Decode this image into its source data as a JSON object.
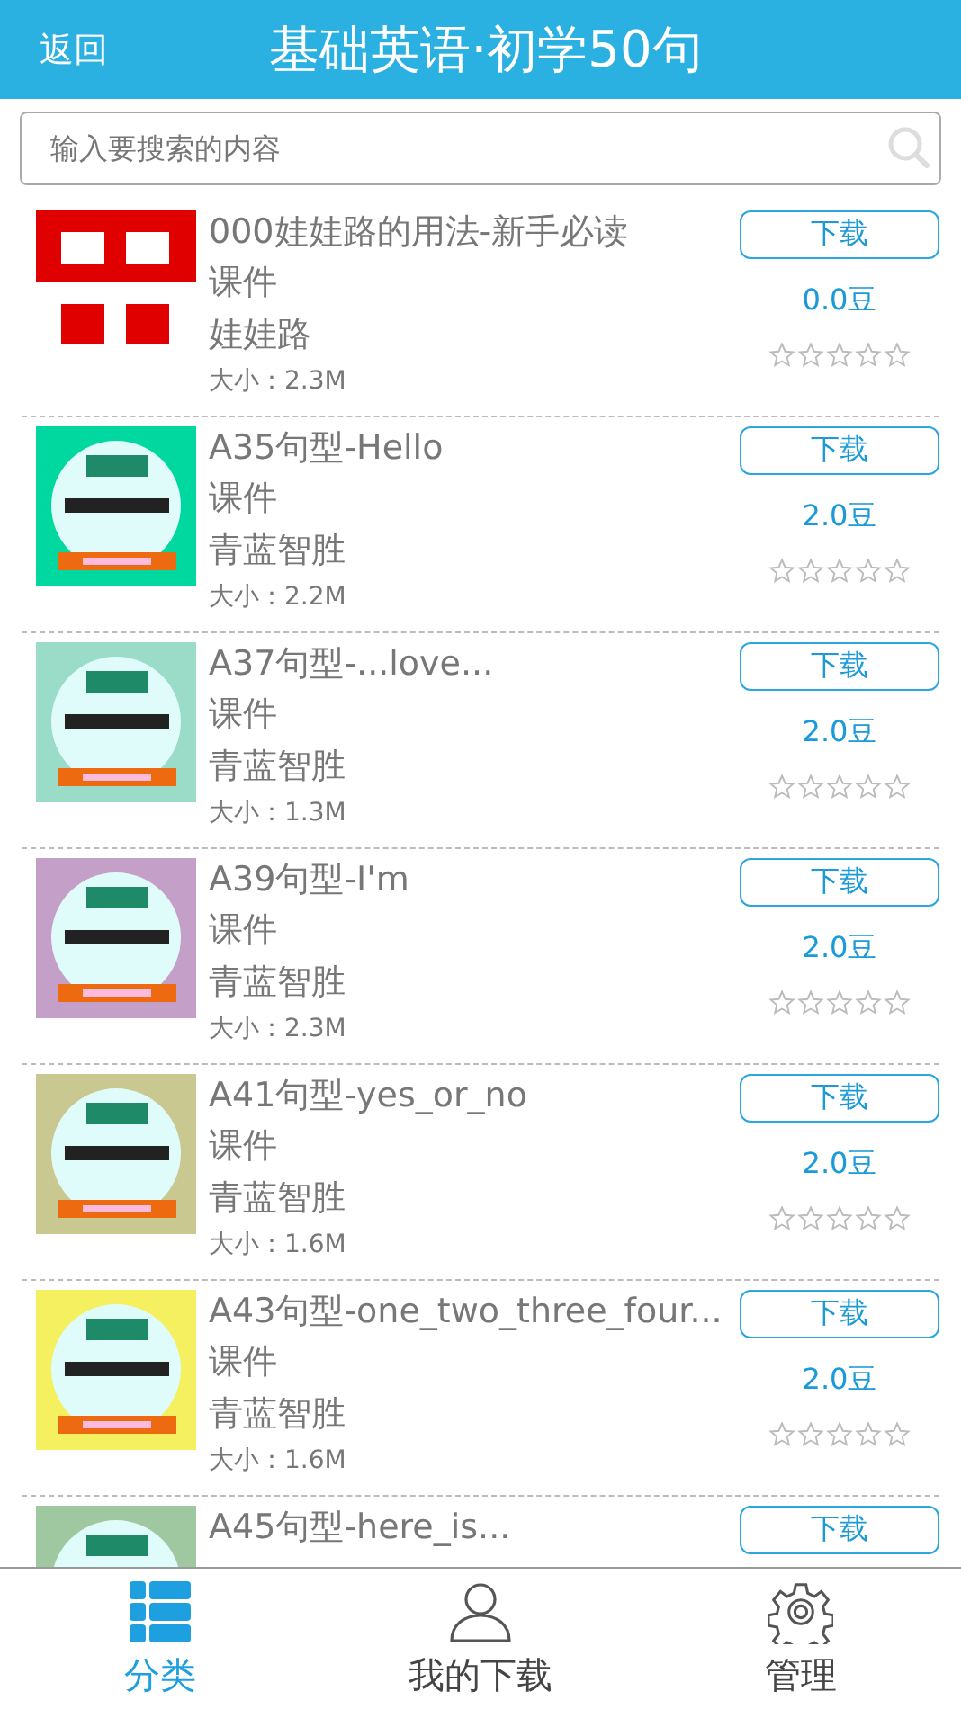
{
  "header": {
    "back": "返回",
    "title": "基础英语·初学50句"
  },
  "search": {
    "placeholder": "输入要搜索的内容"
  },
  "items": [
    {
      "title": "000娃娃路的用法-新手必读",
      "type": "课件",
      "author": "娃娃路",
      "size": "大小：2.3M",
      "button": "下载",
      "price": "0.0豆",
      "stars": 0
    },
    {
      "title": "A35句型-Hello",
      "type": "课件",
      "author": "青蓝智胜",
      "size": "大小：2.2M",
      "button": "下载",
      "price": "2.0豆",
      "stars": 0
    },
    {
      "title": "A37句型-...love...",
      "type": "课件",
      "author": "青蓝智胜",
      "size": "大小：1.3M",
      "button": "下载",
      "price": "2.0豆",
      "stars": 0
    },
    {
      "title": "A39句型-I'm",
      "type": "课件",
      "author": "青蓝智胜",
      "size": "大小：2.3M",
      "button": "下载",
      "price": "2.0豆",
      "stars": 0
    },
    {
      "title": "A41句型-yes_or_no",
      "type": "课件",
      "author": "青蓝智胜",
      "size": "大小：1.6M",
      "button": "下载",
      "price": "2.0豆",
      "stars": 0
    },
    {
      "title": "A43句型-one_two_three_four...",
      "type": "课件",
      "author": "青蓝智胜",
      "size": "大小：1.6M",
      "button": "下载",
      "price": "2.0豆",
      "stars": 0
    },
    {
      "title": "A45句型-here_is...",
      "button": "下载"
    }
  ],
  "tabs": [
    {
      "label": "分类",
      "selected": true
    },
    {
      "label": "我的下载",
      "selected": false
    },
    {
      "label": "管理",
      "selected": false
    }
  ]
}
